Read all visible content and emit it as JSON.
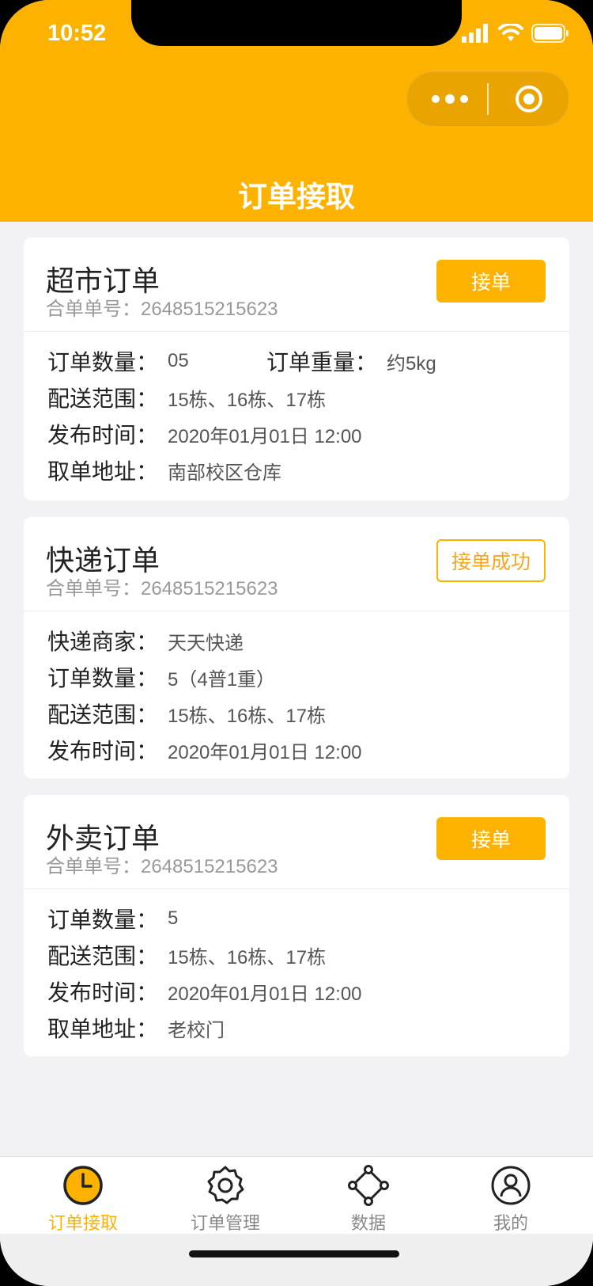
{
  "status_bar": {
    "time": "10:52"
  },
  "header": {
    "title": "订单接取"
  },
  "colors": {
    "accent": "#fdb200",
    "background": "#f2f2f4"
  },
  "orders": [
    {
      "title": "超市订单",
      "order_no_label": "合单单号：",
      "order_no": "2648515215623",
      "button": "接单",
      "fields": [
        {
          "label": "订单数量：",
          "value": "05",
          "label2": "订单重量：",
          "value2": "约5kg"
        },
        {
          "label": "配送范围：",
          "value": "15栋、16栋、17栋"
        },
        {
          "label": "发布时间：",
          "value": "2020年01月01日 12:00"
        },
        {
          "label": "取单地址：",
          "value": "南部校区仓库"
        }
      ]
    },
    {
      "title": "快递订单",
      "order_no_label": "合单单号：",
      "order_no": "2648515215623",
      "button": "接单成功",
      "fields": [
        {
          "label": "快递商家：",
          "value": "天天快递"
        },
        {
          "label": "订单数量：",
          "value": "5（4普1重）"
        },
        {
          "label": "配送范围：",
          "value": "15栋、16栋、17栋"
        },
        {
          "label": "发布时间：",
          "value": "2020年01月01日 12:00"
        }
      ]
    },
    {
      "title": "外卖订单",
      "order_no_label": "合单单号：",
      "order_no": "2648515215623",
      "button": "接单",
      "fields": [
        {
          "label": "订单数量：",
          "value": "5"
        },
        {
          "label": "配送范围：",
          "value": "15栋、16栋、17栋"
        },
        {
          "label": "发布时间：",
          "value": "2020年01月01日 12:00"
        },
        {
          "label": "取单地址：",
          "value": "老校门"
        }
      ]
    }
  ],
  "tabbar": [
    {
      "label": "订单接取",
      "icon": "clock-icon",
      "active": true
    },
    {
      "label": "订单管理",
      "icon": "gear-icon",
      "active": false
    },
    {
      "label": "数据",
      "icon": "network-icon",
      "active": false
    },
    {
      "label": "我的",
      "icon": "user-icon",
      "active": false
    }
  ]
}
